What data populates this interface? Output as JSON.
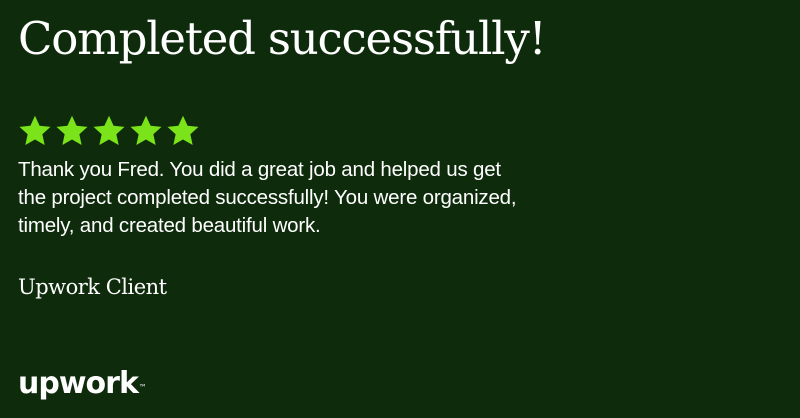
{
  "headline": "Completed successfully!",
  "rating": {
    "stars": 5,
    "max": 5,
    "color": "#7ae319"
  },
  "review_lines": [
    "Thank you Fred. You did a great job and helped us get",
    "the project completed successfully! You were organized,",
    "timely, and created beautiful work."
  ],
  "author": "Upwork Client",
  "brand": {
    "name": "upwork",
    "tm": "™"
  },
  "colors": {
    "background": "#0e2b0c",
    "text": "#ffffff"
  }
}
